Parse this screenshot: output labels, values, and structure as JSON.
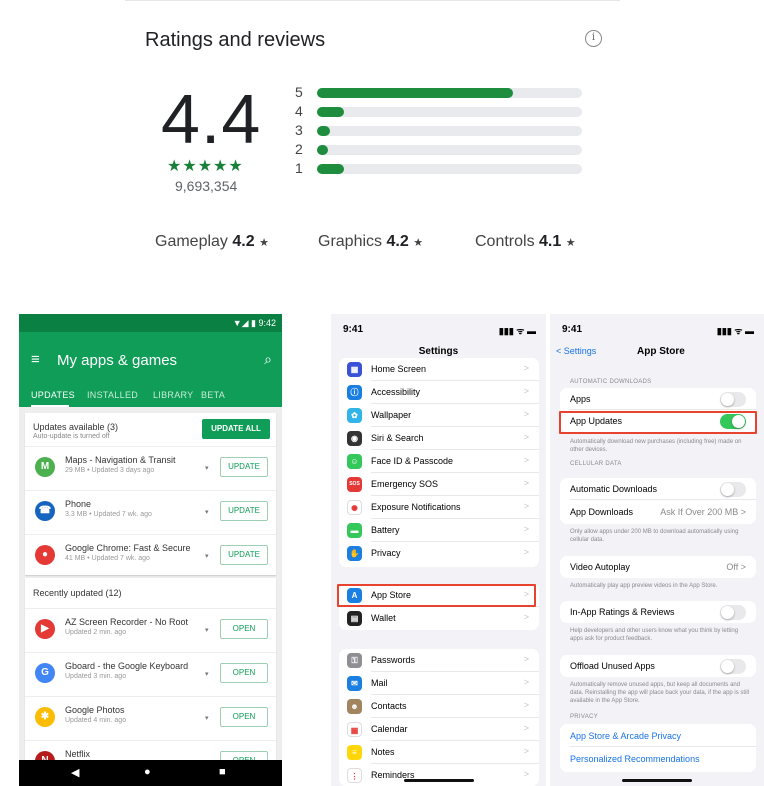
{
  "ratings": {
    "title": "Ratings and reviews",
    "score": "4.4",
    "stars": "★★★★★",
    "count": "9,693,354",
    "distribution": [
      {
        "star": "5",
        "fraction": 0.74
      },
      {
        "star": "4",
        "fraction": 0.1
      },
      {
        "star": "3",
        "fraction": 0.05
      },
      {
        "star": "2",
        "fraction": 0.04
      },
      {
        "star": "1",
        "fraction": 0.1
      }
    ],
    "aspects": [
      {
        "name": "Gameplay",
        "score": "4.2"
      },
      {
        "name": "Graphics",
        "score": "4.2"
      },
      {
        "name": "Controls",
        "score": "4.1"
      }
    ],
    "star_glyph": "★",
    "accent": "#1e8e3e"
  },
  "android": {
    "status": "▼◢ ▮ 9:42",
    "title": "My apps & games",
    "tabs": [
      "UPDATES",
      "INSTALLED",
      "LIBRARY",
      "BETA"
    ],
    "updates_header": "Updates available (3)",
    "updates_sub": "Auto-update is turned off",
    "update_all": "UPDATE ALL",
    "updates": [
      {
        "name": "Maps - Navigation & Transit",
        "meta": "29 MB • Updated 3 days ago",
        "button": "UPDATE",
        "icon": "maps-icon",
        "color": "#4caf50",
        "glyph": "M"
      },
      {
        "name": "Phone",
        "meta": "3.3 MB • Updated 7 wk. ago",
        "button": "UPDATE",
        "icon": "phone-icon",
        "color": "#1565c0",
        "glyph": "☎"
      },
      {
        "name": "Google Chrome: Fast & Secure",
        "meta": "41 MB • Updated 7 wk. ago",
        "button": "UPDATE",
        "icon": "chrome-icon",
        "color": "#e53935",
        "glyph": "●"
      }
    ],
    "recent_header": "Recently updated (12)",
    "recent": [
      {
        "name": "AZ Screen Recorder - No Root",
        "meta": "Updated 2 min. ago",
        "button": "OPEN",
        "icon": "recorder-icon",
        "color": "#e53935",
        "glyph": "▶"
      },
      {
        "name": "Gboard - the Google Keyboard",
        "meta": "Updated 3 min. ago",
        "button": "OPEN",
        "icon": "gboard-icon",
        "color": "#4285f4",
        "glyph": "G"
      },
      {
        "name": "Google Photos",
        "meta": "Updated 4 min. ago",
        "button": "OPEN",
        "icon": "photos-icon",
        "color": "#fbbc04",
        "glyph": "✱"
      },
      {
        "name": "Netflix",
        "meta": "",
        "button": "OPEN",
        "icon": "netflix-icon",
        "color": "#b71c1c",
        "glyph": "N"
      }
    ],
    "nav": [
      "◀",
      "●",
      "■"
    ]
  },
  "ios_settings": {
    "time": "9:41",
    "signal": "▮▮▮ ᯤ ▬",
    "title": "Settings",
    "group1": [
      {
        "label": "Home Screen",
        "color": "#3a52d6",
        "glyph": "▦"
      },
      {
        "label": "Accessibility",
        "color": "#1a7fe0",
        "glyph": "ⓘ"
      },
      {
        "label": "Wallpaper",
        "color": "#31b4e8",
        "glyph": "✿"
      },
      {
        "label": "Siri & Search",
        "color": "#333333",
        "glyph": "◉"
      },
      {
        "label": "Face ID & Passcode",
        "color": "#34c759",
        "glyph": "☺"
      },
      {
        "label": "Emergency SOS",
        "color": "#e53935",
        "glyph": "SOS"
      },
      {
        "label": "Exposure Notifications",
        "color": "#ffffff",
        "glyph": "✺"
      },
      {
        "label": "Battery",
        "color": "#34c759",
        "glyph": "▬"
      },
      {
        "label": "Privacy",
        "color": "#1a7fe0",
        "glyph": "✋"
      }
    ],
    "group2": [
      {
        "label": "App Store",
        "color": "#1a7fe0",
        "glyph": "A"
      },
      {
        "label": "Wallet",
        "color": "#222222",
        "glyph": "▤"
      }
    ],
    "group3": [
      {
        "label": "Passwords",
        "color": "#8e8e93",
        "glyph": "⚿"
      },
      {
        "label": "Mail",
        "color": "#1a7fe0",
        "glyph": "✉"
      },
      {
        "label": "Contacts",
        "color": "#a2845e",
        "glyph": "☻"
      },
      {
        "label": "Calendar",
        "color": "#ffffff",
        "glyph": "▦"
      },
      {
        "label": "Notes",
        "color": "#ffd60a",
        "glyph": "≡"
      },
      {
        "label": "Reminders",
        "color": "#ffffff",
        "glyph": "⋮"
      }
    ],
    "chevron": ">"
  },
  "ios_appstore": {
    "time": "9:41",
    "signal": "▮▮▮ ᯤ ▬",
    "back": "< Settings",
    "title": "App Store",
    "auto_header": "AUTOMATIC DOWNLOADS",
    "apps_label": "Apps",
    "apps_on": false,
    "app_updates_label": "App Updates",
    "app_updates_on": true,
    "auto_footer": "Automatically download new purchases (including free) made on other devices.",
    "cell_header": "CELLULAR DATA",
    "cell_auto_label": "Automatic Downloads",
    "cell_auto_on": false,
    "app_downloads_label": "App Downloads",
    "app_downloads_value": "Ask If Over 200 MB >",
    "cell_footer": "Only allow apps under 200 MB to download automatically using cellular data.",
    "video_label": "Video Autoplay",
    "video_value": "Off >",
    "video_footer": "Automatically play app preview videos in the App Store.",
    "ratings_label": "In-App Ratings & Reviews",
    "ratings_on": false,
    "ratings_footer": "Help developers and other users know what you think by letting apps ask for product feedback.",
    "offload_label": "Offload Unused Apps",
    "offload_on": false,
    "offload_footer": "Automatically remove unused apps, but keep all documents and data. Reinstalling the app will place back your data, if the app is still available in the App Store.",
    "privacy_header": "PRIVACY",
    "privacy_link": "App Store & Arcade Privacy",
    "recommend_link": "Personalized Recommendations"
  }
}
